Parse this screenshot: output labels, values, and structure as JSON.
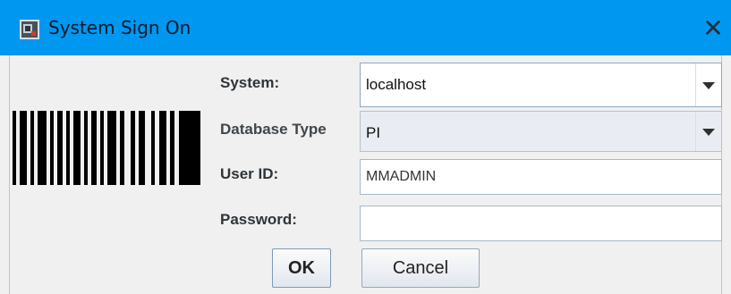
{
  "window": {
    "title": "System Sign On",
    "close_label": "✕",
    "icon": "app-icon"
  },
  "barcode": {
    "icon": "barcode-icon"
  },
  "form": {
    "system": {
      "label": "System:",
      "value": "localhost"
    },
    "database_type": {
      "label": "Database Type",
      "value": "PI"
    },
    "user_id": {
      "label": "User ID:",
      "value": "MMADMIN"
    },
    "password": {
      "label": "Password:",
      "value": ""
    }
  },
  "buttons": {
    "ok": "OK",
    "cancel": "Cancel"
  },
  "colors": {
    "titlebar": "#0097f0",
    "window_bg": "#f0f0f0",
    "field_border": "#8da7c4"
  }
}
